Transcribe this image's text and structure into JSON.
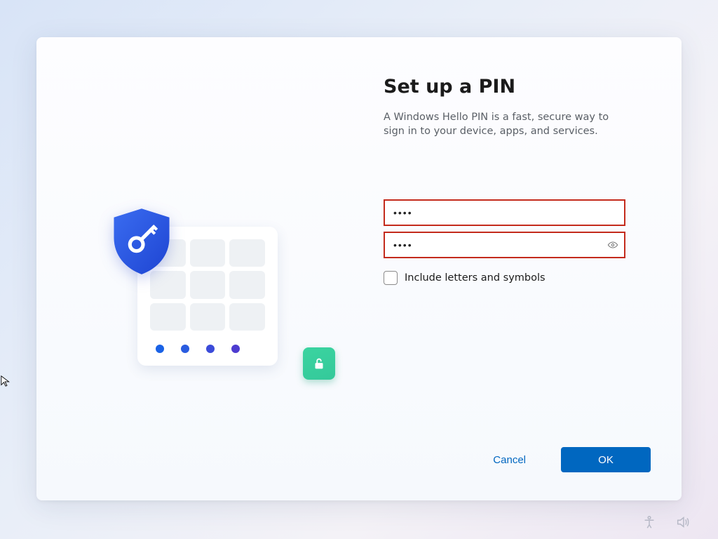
{
  "dialog": {
    "title": "Set up a PIN",
    "description": "A Windows Hello PIN is a fast, secure way to sign in to your device, apps, and services.",
    "pin_value": "••••",
    "confirm_value": "••••",
    "checkbox_label": "Include letters and symbols",
    "cancel_label": "Cancel",
    "ok_label": "OK"
  },
  "tray": {
    "accessibility": "accessibility",
    "volume": "volume"
  },
  "colors": {
    "primary": "#0067c0",
    "error_border": "#c42b1c",
    "shield_blue": "#2b5ce8",
    "unlock_green": "#34c99a"
  }
}
